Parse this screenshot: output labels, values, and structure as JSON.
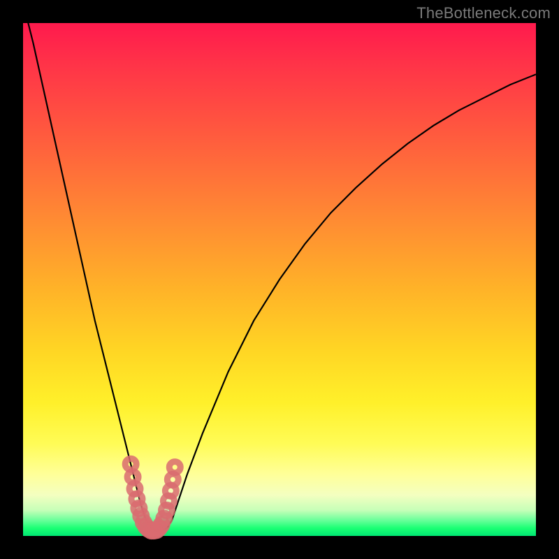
{
  "watermark": "TheBottleneck.com",
  "colors": {
    "frame_bg": "#000000",
    "curve_stroke": "#000000",
    "marker_stroke": "#d96b70",
    "marker_fill": "none"
  },
  "chart_data": {
    "type": "line",
    "title": "",
    "xlabel": "",
    "ylabel": "",
    "xlim": [
      0,
      100
    ],
    "ylim": [
      0,
      100
    ],
    "grid": false,
    "series": [
      {
        "name": "bottleneck-curve",
        "x": [
          0,
          2,
          4,
          6,
          8,
          10,
          12,
          14,
          16,
          18,
          20,
          21,
          22,
          23,
          24,
          25,
          26,
          27,
          28,
          29,
          30,
          32,
          35,
          40,
          45,
          50,
          55,
          60,
          65,
          70,
          75,
          80,
          85,
          90,
          95,
          100
        ],
        "values": [
          104,
          96,
          87,
          78,
          69,
          60,
          51,
          42,
          34,
          26,
          18,
          14,
          10,
          6,
          3,
          1.5,
          1,
          1,
          1.5,
          3,
          6,
          12,
          20,
          32,
          42,
          50,
          57,
          63,
          68,
          72.5,
          76.5,
          80,
          83,
          85.5,
          88,
          90
        ]
      }
    ],
    "markers": {
      "name": "highlight-cluster",
      "x_range": [
        21,
        29
      ],
      "y_range": [
        0,
        14
      ],
      "points": [
        {
          "x": 21.0,
          "y": 14.0
        },
        {
          "x": 21.4,
          "y": 11.5
        },
        {
          "x": 21.8,
          "y": 9.2
        },
        {
          "x": 22.2,
          "y": 7.2
        },
        {
          "x": 22.6,
          "y": 5.4
        },
        {
          "x": 23.0,
          "y": 3.9
        },
        {
          "x": 23.5,
          "y": 2.6
        },
        {
          "x": 24.0,
          "y": 1.8
        },
        {
          "x": 24.5,
          "y": 1.3
        },
        {
          "x": 25.0,
          "y": 1.0
        },
        {
          "x": 25.5,
          "y": 1.0
        },
        {
          "x": 26.0,
          "y": 1.1
        },
        {
          "x": 26.5,
          "y": 1.5
        },
        {
          "x": 27.0,
          "y": 2.2
        },
        {
          "x": 27.5,
          "y": 3.4
        },
        {
          "x": 28.0,
          "y": 5.0
        },
        {
          "x": 28.4,
          "y": 6.8
        },
        {
          "x": 28.8,
          "y": 8.8
        },
        {
          "x": 29.2,
          "y": 11.0
        },
        {
          "x": 29.6,
          "y": 13.4
        }
      ]
    }
  }
}
